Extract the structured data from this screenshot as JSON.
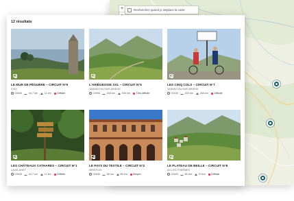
{
  "map": {
    "search_label": "Rechercher quand je déplace la carte",
    "zoom_in": "+",
    "zoom_out": "−",
    "pin_color": "#0f5c62"
  },
  "results": {
    "count_label": "12 résultats",
    "cards": [
      {
        "title": "LE MUR DE PÉGUÈRE – CIRCUIT N°9",
        "subtitle": "FOIX",
        "duration": "03h00",
        "distance": "44,7 km",
        "elevation": "11 km",
        "difficulty": "Difficile",
        "image": "stone-monument-landscape"
      },
      {
        "title": "L'ARIÉGEOISE XXL – CIRCUIT N°6",
        "subtitle": "TARASCON-SUR-ARIÈGE",
        "duration": "02h00",
        "distance": "160 km",
        "elevation": "400 km",
        "difficulty": "Très difficile",
        "image": "mountain-valley"
      },
      {
        "title": "LES CINQ COLS – CIRCUIT N°7",
        "subtitle": "TARASCON-SUR-ARIÈGE",
        "duration": "01h30",
        "distance": "200 km",
        "elevation": "265 km",
        "difficulty": "Difficile",
        "image": "cyclists-col-sign"
      },
      {
        "title": "LES CHÂTEAUX CATHARES – CIRCUIT N°1",
        "subtitle": "LAVELANET",
        "duration": "03h45",
        "distance": "44,7 km",
        "elevation": "11 km",
        "difficulty": "Difficile",
        "image": "signpost-forest"
      },
      {
        "title": "LE PAYS DU TEXTILE – CIRCUIT N°2",
        "subtitle": "MIREPOIX",
        "duration": "02h30",
        "distance": "58 km",
        "elevation": "85 km",
        "difficulty": "Moyen",
        "image": "medieval-square"
      },
      {
        "title": "LE PLATEAU DE BEILLE – CIRCUIT N°8",
        "subtitle": "AX-LES-THERMES",
        "duration": "02h00",
        "distance": "60 km",
        "elevation": "70 km",
        "difficulty": "Difficile",
        "image": "mountain-village"
      }
    ]
  }
}
